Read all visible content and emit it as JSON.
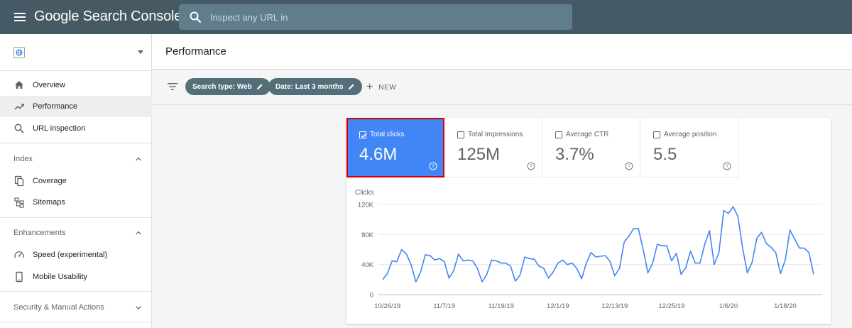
{
  "app": {
    "title": "Google Search Console",
    "search_placeholder": "Inspect any URL in"
  },
  "sidebar": {
    "nav": [
      {
        "label": "Overview",
        "icon": "home-icon"
      },
      {
        "label": "Performance",
        "icon": "trending-up-icon",
        "active": true
      },
      {
        "label": "URL inspection",
        "icon": "search-icon"
      }
    ],
    "sections": [
      {
        "label": "Index",
        "expanded": true,
        "items": [
          {
            "label": "Coverage",
            "icon": "file-copy-icon"
          },
          {
            "label": "Sitemaps",
            "icon": "sitemap-icon"
          }
        ]
      },
      {
        "label": "Enhancements",
        "expanded": true,
        "items": [
          {
            "label": "Speed (experimental)",
            "icon": "speed-gauge-icon"
          },
          {
            "label": "Mobile Usability",
            "icon": "smartphone-icon"
          }
        ]
      },
      {
        "label": "Security & Manual Actions",
        "expanded": false,
        "items": []
      }
    ]
  },
  "page": {
    "title": "Performance"
  },
  "filters": {
    "chips": [
      "Search type: Web",
      "Date: Last 3 months"
    ],
    "new_label": "NEW"
  },
  "metrics": [
    {
      "label": "Total clicks",
      "value": "4.6M",
      "selected": true
    },
    {
      "label": "Total impressions",
      "value": "125M",
      "selected": false
    },
    {
      "label": "Average CTR",
      "value": "3.7%",
      "selected": false
    },
    {
      "label": "Average position",
      "value": "5.5",
      "selected": false
    }
  ],
  "colors": {
    "topbar": "#455a64",
    "accent_blue": "#4285f4",
    "chip": "#546e7a",
    "highlight_border": "#d50000"
  },
  "chart_data": {
    "type": "line",
    "ylabel": "Clicks",
    "ylim": [
      0,
      120000
    ],
    "yticks": [
      {
        "value": 0,
        "label": "0"
      },
      {
        "value": 40000,
        "label": "40K"
      },
      {
        "value": 80000,
        "label": "80K"
      },
      {
        "value": 120000,
        "label": "120K"
      }
    ],
    "xticks": [
      {
        "index": 1,
        "label": "10/26/19"
      },
      {
        "index": 13,
        "label": "11/7/19"
      },
      {
        "index": 25,
        "label": "11/19/19"
      },
      {
        "index": 37,
        "label": "12/1/19"
      },
      {
        "index": 49,
        "label": "12/13/19"
      },
      {
        "index": 61,
        "label": "12/25/19"
      },
      {
        "index": 73,
        "label": "1/6/20"
      },
      {
        "index": 85,
        "label": "1/18/20"
      }
    ],
    "grid": true,
    "series": [
      {
        "color": "#4285f4",
        "values": [
          20000,
          28000,
          45000,
          44000,
          60000,
          54000,
          40000,
          17000,
          30000,
          53000,
          52000,
          46000,
          48000,
          44000,
          22000,
          32000,
          54000,
          45000,
          46000,
          45000,
          35000,
          17000,
          27000,
          46000,
          45000,
          42000,
          42000,
          38000,
          18000,
          26000,
          50000,
          48000,
          47000,
          38000,
          35000,
          22000,
          30000,
          42000,
          46000,
          40000,
          42000,
          35000,
          21000,
          42000,
          56000,
          50000,
          51000,
          52000,
          44000,
          25000,
          35000,
          70000,
          78000,
          88000,
          88000,
          60000,
          29000,
          42000,
          67000,
          65000,
          65000,
          45000,
          55000,
          27000,
          36000,
          58000,
          42000,
          42000,
          67000,
          85000,
          40000,
          56000,
          112000,
          108000,
          117000,
          104000,
          62000,
          29000,
          43000,
          75000,
          83000,
          68000,
          63000,
          56000,
          28000,
          46000,
          86000,
          74000,
          62000,
          62000,
          56000,
          27000
        ]
      }
    ]
  }
}
